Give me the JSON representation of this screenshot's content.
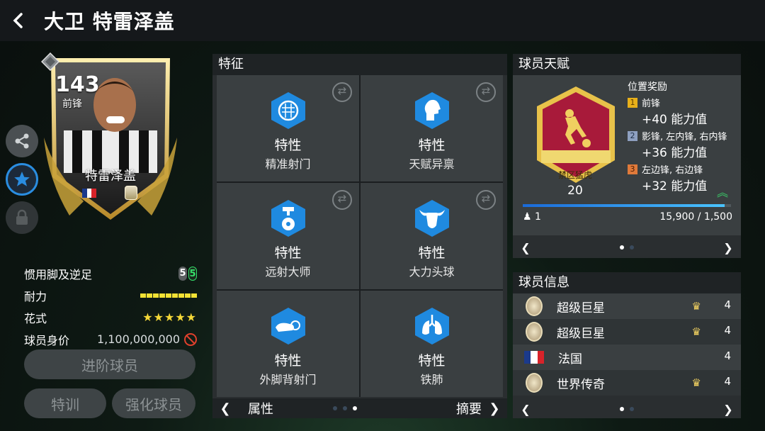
{
  "header": {
    "title": "大卫 特雷泽盖"
  },
  "card": {
    "rating": "143",
    "position": "前锋",
    "name": "特雷泽盖",
    "nation_colors": [
      "#1b3a8c",
      "#ffffff",
      "#d8232a"
    ]
  },
  "stats": {
    "weak_foot_label": "惯用脚及逆足",
    "weak_foot_left": "5",
    "weak_foot_right": "5",
    "stamina_label": "耐力",
    "stamina_level": 1.0,
    "skill_label": "花式",
    "skill_stars": "★★★★★",
    "value_label": "球员身价",
    "value": "1,100,000,000"
  },
  "buttons": {
    "advance": "进阶球员",
    "train": "特训",
    "enhance": "强化球员"
  },
  "traits": {
    "title": "特征",
    "items": [
      {
        "type": "特性",
        "name": "精准射门",
        "icon": "goal-net-icon"
      },
      {
        "type": "特性",
        "name": "天赋异禀",
        "icon": "head-profile-icon"
      },
      {
        "type": "特性",
        "name": "远射大师",
        "icon": "long-shot-icon"
      },
      {
        "type": "特性",
        "name": "大力头球",
        "icon": "bull-head-icon"
      },
      {
        "type": "特性",
        "name": "外脚背射门",
        "icon": "outside-foot-icon"
      },
      {
        "type": "特性",
        "name": "铁肺",
        "icon": "lungs-icon"
      }
    ],
    "footer_left": "属性",
    "footer_right": "摘要"
  },
  "talent": {
    "title": "球员天赋",
    "badge_name": "禁区猛虎",
    "badge_level": "20",
    "bonus_title": "位置奖励",
    "bonuses": [
      {
        "rank": "1",
        "positions": "前锋",
        "value": "+40 能力值"
      },
      {
        "rank": "2",
        "positions": "影锋, 左内锋, 右内锋",
        "value": "+36 能力值"
      },
      {
        "rank": "3",
        "positions": "左边锋, 右边锋",
        "value": "+32 能力值"
      }
    ],
    "progress_fraction": 0.97,
    "owned_count": "1",
    "progress_text": "15,900 / 1,500"
  },
  "info": {
    "title": "球员信息",
    "rows": [
      {
        "label": "超级巨星",
        "level": "4"
      },
      {
        "label": "超级巨星",
        "level": "4"
      },
      {
        "label": "法国",
        "level": "4"
      },
      {
        "label": "世界传奇",
        "level": "4"
      }
    ]
  },
  "colors": {
    "accent_blue": "#1f8ae0",
    "gold": "#e8c24a",
    "green": "#35e06a"
  }
}
